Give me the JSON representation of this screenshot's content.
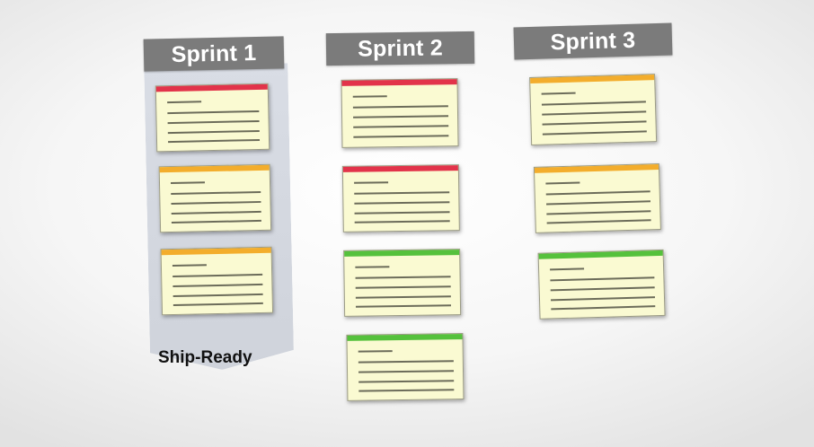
{
  "columns": [
    {
      "title": "Sprint 1",
      "cards": [
        {
          "color": "red"
        },
        {
          "color": "orange"
        },
        {
          "color": "orange"
        }
      ]
    },
    {
      "title": "Sprint 2",
      "cards": [
        {
          "color": "red"
        },
        {
          "color": "red"
        },
        {
          "color": "green"
        },
        {
          "color": "green"
        }
      ]
    },
    {
      "title": "Sprint 3",
      "cards": [
        {
          "color": "orange"
        },
        {
          "color": "orange"
        },
        {
          "color": "green"
        }
      ]
    }
  ],
  "ship_ready_label": "Ship-Ready",
  "colors": {
    "red": "#e2334a",
    "orange": "#f3ad2c",
    "green": "#55c13c",
    "card": "#fafad2",
    "header": "#7b7b7b"
  }
}
